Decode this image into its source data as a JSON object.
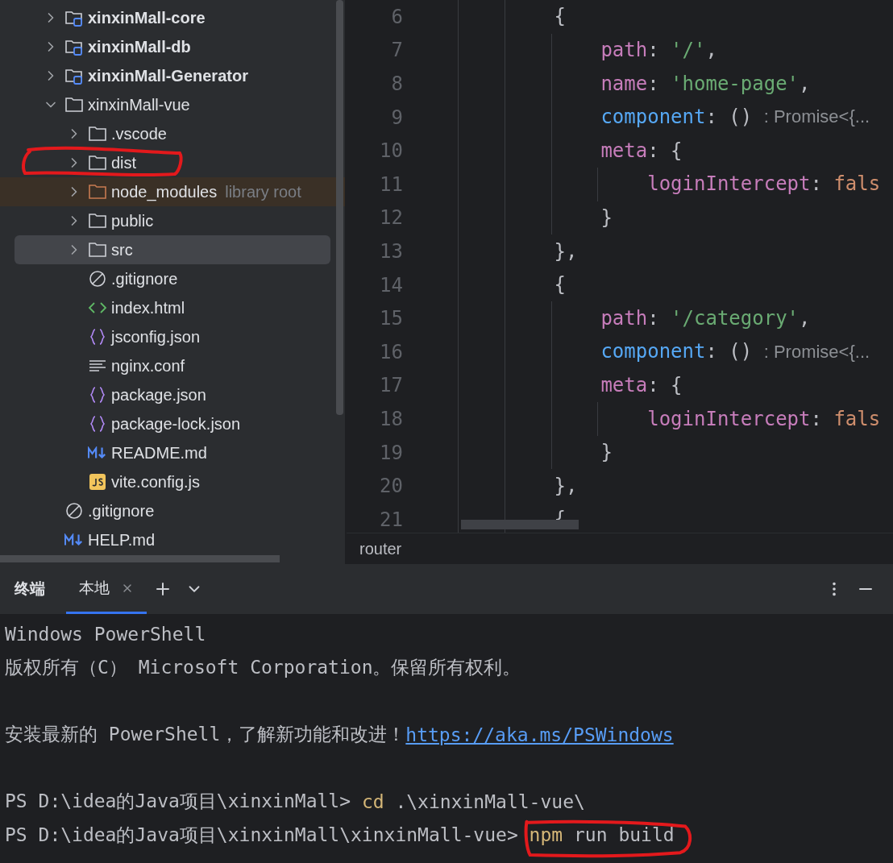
{
  "project_tree": {
    "items": [
      {
        "label": "xinxinMall-core",
        "kind": "module",
        "expanded": false,
        "selected": false,
        "circled": false
      },
      {
        "label": "xinxinMall-db",
        "kind": "module",
        "expanded": false,
        "selected": false,
        "circled": false
      },
      {
        "label": "xinxinMall-Generator",
        "kind": "module",
        "expanded": false,
        "selected": false,
        "circled": false
      },
      {
        "label": "xinxinMall-vue",
        "kind": "folder",
        "expanded": true,
        "selected": false,
        "circled": false,
        "children": [
          {
            "label": ".vscode",
            "kind": "folder",
            "expanded": false,
            "selected": false,
            "circled": false
          },
          {
            "label": "dist",
            "kind": "folder",
            "expanded": false,
            "selected": false,
            "circled": true
          },
          {
            "label": "node_modules",
            "hint": "library root",
            "kind": "library",
            "expanded": false,
            "selected": false,
            "circled": false
          },
          {
            "label": "public",
            "kind": "folder",
            "expanded": false,
            "selected": false,
            "circled": false
          },
          {
            "label": "src",
            "kind": "folder",
            "expanded": false,
            "selected": true,
            "circled": false
          },
          {
            "label": ".gitignore",
            "kind": "ignore",
            "selected": false,
            "circled": false
          },
          {
            "label": "index.html",
            "kind": "html",
            "selected": false,
            "circled": false
          },
          {
            "label": "jsconfig.json",
            "kind": "json",
            "selected": false,
            "circled": false
          },
          {
            "label": "nginx.conf",
            "kind": "text",
            "selected": false,
            "circled": false
          },
          {
            "label": "package.json",
            "kind": "json",
            "selected": false,
            "circled": false
          },
          {
            "label": "package-lock.json",
            "kind": "json",
            "selected": false,
            "circled": false
          },
          {
            "label": "README.md",
            "kind": "markdown",
            "selected": false,
            "circled": false
          },
          {
            "label": "vite.config.js",
            "kind": "js",
            "selected": false,
            "circled": false
          }
        ]
      },
      {
        "label": ".gitignore",
        "kind": "ignore",
        "selected": false,
        "circled": false
      },
      {
        "label": "HELP.md",
        "kind": "markdown",
        "selected": false,
        "circled": false
      }
    ]
  },
  "editor": {
    "lines": [
      {
        "number": "6",
        "tokens": [
          {
            "kind": "punct",
            "text": "        {"
          }
        ]
      },
      {
        "number": "7",
        "tokens": [
          {
            "kind": "key",
            "text": "            path"
          },
          {
            "kind": "punct",
            "text": ": "
          },
          {
            "kind": "string",
            "text": "'/'"
          },
          {
            "kind": "punct",
            "text": ","
          }
        ]
      },
      {
        "number": "8",
        "tokens": [
          {
            "kind": "key",
            "text": "            name"
          },
          {
            "kind": "punct",
            "text": ": "
          },
          {
            "kind": "string",
            "text": "'home-page'"
          },
          {
            "kind": "punct",
            "text": ","
          }
        ]
      },
      {
        "number": "9",
        "tokens": [
          {
            "kind": "method",
            "text": "            component"
          },
          {
            "kind": "punct",
            "text": ": () "
          },
          {
            "kind": "hint",
            "text": ": Promise<{..."
          }
        ]
      },
      {
        "number": "10",
        "tokens": [
          {
            "kind": "key",
            "text": "            meta"
          },
          {
            "kind": "punct",
            "text": ": {"
          }
        ]
      },
      {
        "number": "11",
        "tokens": [
          {
            "kind": "key",
            "text": "                loginIntercept"
          },
          {
            "kind": "punct",
            "text": ": "
          },
          {
            "kind": "keyword",
            "text": "fals"
          }
        ]
      },
      {
        "number": "12",
        "tokens": [
          {
            "kind": "punct",
            "text": "            }"
          }
        ]
      },
      {
        "number": "13",
        "tokens": [
          {
            "kind": "punct",
            "text": "        },"
          }
        ]
      },
      {
        "number": "14",
        "tokens": [
          {
            "kind": "punct",
            "text": "        {"
          }
        ]
      },
      {
        "number": "15",
        "tokens": [
          {
            "kind": "key",
            "text": "            path"
          },
          {
            "kind": "punct",
            "text": ": "
          },
          {
            "kind": "string",
            "text": "'/category'"
          },
          {
            "kind": "punct",
            "text": ","
          }
        ]
      },
      {
        "number": "16",
        "tokens": [
          {
            "kind": "method",
            "text": "            component"
          },
          {
            "kind": "punct",
            "text": ": () "
          },
          {
            "kind": "hint",
            "text": ": Promise<{..."
          }
        ]
      },
      {
        "number": "17",
        "tokens": [
          {
            "kind": "key",
            "text": "            meta"
          },
          {
            "kind": "punct",
            "text": ": {"
          }
        ]
      },
      {
        "number": "18",
        "tokens": [
          {
            "kind": "key",
            "text": "                loginIntercept"
          },
          {
            "kind": "punct",
            "text": ": "
          },
          {
            "kind": "keyword",
            "text": "fals"
          }
        ]
      },
      {
        "number": "19",
        "tokens": [
          {
            "kind": "punct",
            "text": "            }"
          }
        ]
      },
      {
        "number": "20",
        "tokens": [
          {
            "kind": "punct",
            "text": "        },"
          }
        ]
      },
      {
        "number": "21",
        "tokens": [
          {
            "kind": "punct",
            "text": "        {"
          }
        ]
      }
    ],
    "breadcrumb": "router"
  },
  "terminal": {
    "title": "终端",
    "tabs": [
      {
        "label": "本地",
        "selected": true
      }
    ],
    "blocks": [
      {
        "lines": [
          {
            "tokens": [
              {
                "kind": "text",
                "text": "Windows PowerShell",
                "circled": false
              }
            ]
          },
          {
            "tokens": [
              {
                "kind": "text",
                "text": "版权所有（C） Microsoft Corporation。保留所有权利。",
                "circled": false
              }
            ]
          }
        ]
      },
      {
        "lines": [
          {
            "tokens": [
              {
                "kind": "text",
                "text": "安装最新的 PowerShell，了解新功能和改进！",
                "circled": false
              },
              {
                "kind": "link",
                "text": "https://aka.ms/PSWindows",
                "circled": false
              }
            ]
          }
        ]
      },
      {
        "lines": [
          {
            "tokens": [
              {
                "kind": "text",
                "text": "PS D:\\idea的Java项目\\xinxinMall> ",
                "circled": false
              },
              {
                "kind": "command",
                "text": "cd",
                "circled": false
              },
              {
                "kind": "text",
                "text": " .\\xinxinMall-vue\\",
                "circled": false
              }
            ]
          },
          {
            "tokens": [
              {
                "kind": "text",
                "text": "PS D:\\idea的Java项目\\xinxinMall\\xinxinMall-vue> ",
                "circled": false
              },
              {
                "kind": "command",
                "text": "npm",
                "circled": true
              },
              {
                "kind": "text",
                "text": " run build",
                "circled": true
              }
            ]
          }
        ]
      }
    ]
  }
}
